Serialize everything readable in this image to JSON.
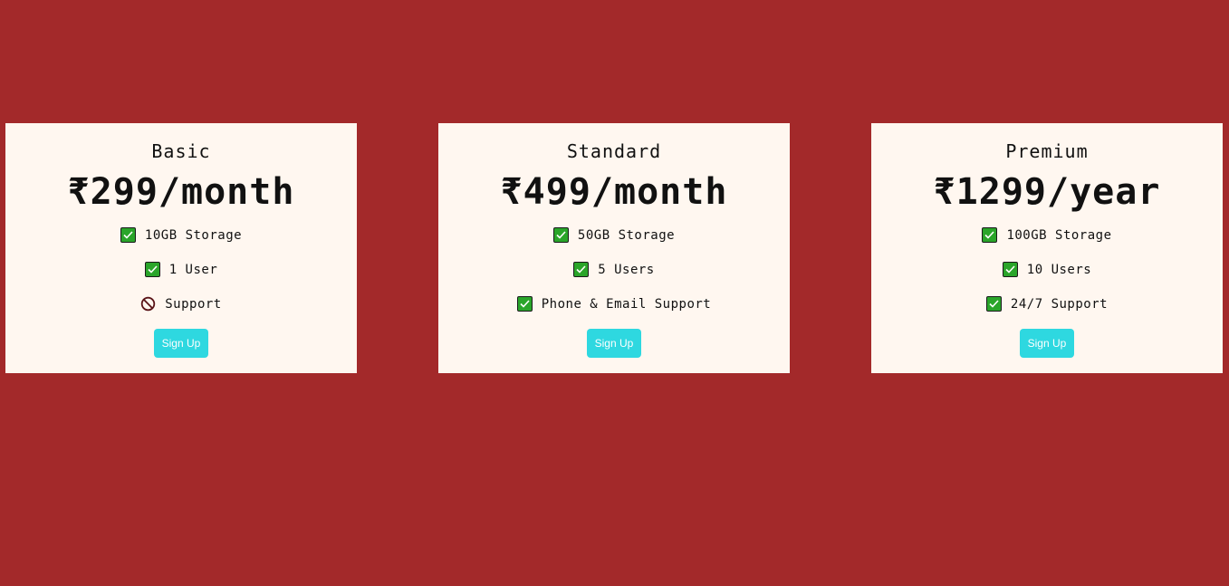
{
  "colors": {
    "background": "#a3292a",
    "card": "#fff7f0",
    "button": "#2ed8e0",
    "check": "#2aa52a"
  },
  "plans": [
    {
      "name": "Basic",
      "price": "₹299/month",
      "features": [
        {
          "icon": "check-icon",
          "text": "10GB Storage"
        },
        {
          "icon": "check-icon",
          "text": "1 User"
        },
        {
          "icon": "no-entry-icon",
          "text": "Support"
        }
      ],
      "button_label": "Sign Up"
    },
    {
      "name": "Standard",
      "price": "₹499/month",
      "features": [
        {
          "icon": "check-icon",
          "text": "50GB Storage"
        },
        {
          "icon": "check-icon",
          "text": "5 Users"
        },
        {
          "icon": "check-icon",
          "text": "Phone & Email Support"
        }
      ],
      "button_label": "Sign Up"
    },
    {
      "name": "Premium",
      "price": "₹1299/year",
      "features": [
        {
          "icon": "check-icon",
          "text": "100GB Storage"
        },
        {
          "icon": "check-icon",
          "text": "10 Users"
        },
        {
          "icon": "check-icon",
          "text": "24/7 Support"
        }
      ],
      "button_label": "Sign Up"
    }
  ]
}
